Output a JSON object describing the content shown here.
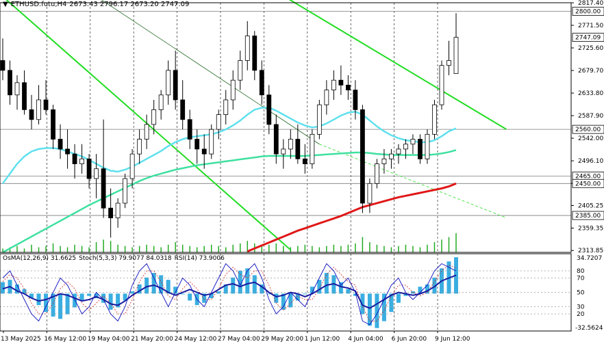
{
  "header": {
    "symbol": "ETHUSD.futu,H4",
    "ohlc": "2673.43 2796.17 2673.20 2747.09"
  },
  "indicator_header": {
    "osma": "OsMA(12,26,9) 31.6625",
    "stoch": "Stoch(5,3,3) 79.9077 84.0318",
    "rsi": "RSI(14) 73.9006"
  },
  "colors": {
    "candle": "#000000",
    "ma_fast": "#5fe0ee",
    "ma_mid": "#3ee0a0",
    "ma_slow": "#e01818",
    "trendline": "#22dd22",
    "osma": "#3aaee0",
    "stoch_main": "#1010c0",
    "stoch_signal": "#d02020",
    "rsi": "#1a1aa0",
    "price_box": "#ffffff"
  },
  "chart_data": [
    {
      "type": "candlestick",
      "title": "ETHUSD.futu,H4",
      "ylim": [
        2310,
        2817.4
      ],
      "y_ticks": [
        "2817.40",
        "2771.50",
        "2725.60",
        "2679.70",
        "2633.80",
        "2587.90",
        "2542.00",
        "2496.10",
        "2450.20",
        "2405.25",
        "2359.35",
        "2313.85"
      ],
      "price_labels": [
        "2800.00",
        "2747.09",
        "2560.00",
        "2465.00",
        "2450.00",
        "2385.00"
      ],
      "levels": [
        2800.0,
        2560.0,
        2465.0,
        2450.0,
        2385.0
      ],
      "current_price": 2747.09,
      "x_labels": [
        "13 May 2025",
        "16 May 12:00",
        "19 May 04:00",
        "21 May 20:00",
        "24 May 12:00",
        "27 May 04:00",
        "29 May 20:00",
        "1 Jun 12:00",
        "4 Jun 04:00",
        "6 Jun 20:00",
        "9 Jun 12:00"
      ],
      "candles": [
        [
          2700,
          2745,
          2660,
          2680
        ],
        [
          2680,
          2700,
          2610,
          2630
        ],
        [
          2630,
          2670,
          2600,
          2655
        ],
        [
          2655,
          2680,
          2590,
          2600
        ],
        [
          2600,
          2630,
          2560,
          2580
        ],
        [
          2580,
          2650,
          2570,
          2620
        ],
        [
          2620,
          2660,
          2590,
          2600
        ],
        [
          2600,
          2610,
          2520,
          2540
        ],
        [
          2540,
          2570,
          2500,
          2520
        ],
        [
          2520,
          2560,
          2480,
          2510
        ],
        [
          2510,
          2530,
          2460,
          2490
        ],
        [
          2490,
          2530,
          2470,
          2500
        ],
        [
          2500,
          2510,
          2440,
          2460
        ],
        [
          2460,
          2510,
          2420,
          2480
        ],
        [
          2480,
          2580,
          2380,
          2400
        ],
        [
          2400,
          2440,
          2340,
          2380
        ],
        [
          2380,
          2420,
          2360,
          2410
        ],
        [
          2410,
          2470,
          2400,
          2460
        ],
        [
          2460,
          2520,
          2440,
          2510
        ],
        [
          2510,
          2560,
          2490,
          2540
        ],
        [
          2540,
          2590,
          2520,
          2570
        ],
        [
          2570,
          2620,
          2550,
          2600
        ],
        [
          2600,
          2640,
          2580,
          2630
        ],
        [
          2630,
          2700,
          2610,
          2680
        ],
        [
          2680,
          2720,
          2600,
          2620
        ],
        [
          2620,
          2660,
          2560,
          2580
        ],
        [
          2580,
          2600,
          2520,
          2540
        ],
        [
          2540,
          2560,
          2490,
          2520
        ],
        [
          2520,
          2550,
          2480,
          2510
        ],
        [
          2510,
          2570,
          2500,
          2560
        ],
        [
          2560,
          2600,
          2540,
          2590
        ],
        [
          2590,
          2640,
          2570,
          2620
        ],
        [
          2620,
          2680,
          2600,
          2660
        ],
        [
          2660,
          2720,
          2640,
          2700
        ],
        [
          2700,
          2780,
          2680,
          2750
        ],
        [
          2750,
          2760,
          2660,
          2680
        ],
        [
          2680,
          2700,
          2610,
          2630
        ],
        [
          2630,
          2650,
          2550,
          2570
        ],
        [
          2570,
          2590,
          2490,
          2510
        ],
        [
          2510,
          2540,
          2480,
          2520
        ],
        [
          2520,
          2560,
          2500,
          2540
        ],
        [
          2540,
          2570,
          2490,
          2500
        ],
        [
          2500,
          2530,
          2470,
          2490
        ],
        [
          2490,
          2560,
          2480,
          2550
        ],
        [
          2550,
          2620,
          2540,
          2610
        ],
        [
          2610,
          2660,
          2590,
          2640
        ],
        [
          2640,
          2680,
          2620,
          2660
        ],
        [
          2660,
          2690,
          2630,
          2650
        ],
        [
          2650,
          2670,
          2620,
          2640
        ],
        [
          2640,
          2660,
          2580,
          2600
        ],
        [
          2600,
          2610,
          2390,
          2410
        ],
        [
          2410,
          2460,
          2390,
          2450
        ],
        [
          2450,
          2500,
          2440,
          2490
        ],
        [
          2490,
          2520,
          2470,
          2500
        ],
        [
          2500,
          2520,
          2480,
          2510
        ],
        [
          2510,
          2530,
          2490,
          2520
        ],
        [
          2520,
          2540,
          2500,
          2530
        ],
        [
          2530,
          2550,
          2510,
          2540
        ],
        [
          2540,
          2550,
          2490,
          2500
        ],
        [
          2500,
          2560,
          2490,
          2550
        ],
        [
          2550,
          2620,
          2540,
          2610
        ],
        [
          2610,
          2700,
          2600,
          2690
        ],
        [
          2690,
          2740,
          2670,
          2700
        ],
        [
          2673.43,
          2796.17,
          2673.2,
          2747.09
        ]
      ],
      "ma_fast": [
        2450,
        2470,
        2490,
        2505,
        2515,
        2520,
        2522,
        2522,
        2520,
        2515,
        2510,
        2505,
        2498,
        2490,
        2482,
        2476,
        2474,
        2478,
        2484,
        2492,
        2500,
        2508,
        2516,
        2526,
        2534,
        2540,
        2544,
        2546,
        2548,
        2550,
        2554,
        2560,
        2568,
        2578,
        2590,
        2600,
        2604,
        2604,
        2598,
        2590,
        2582,
        2574,
        2568,
        2564,
        2566,
        2572,
        2580,
        2588,
        2594,
        2596,
        2590,
        2578,
        2566,
        2556,
        2548,
        2542,
        2538,
        2536,
        2534,
        2534,
        2538,
        2546,
        2556,
        2562
      ],
      "ma_mid": [
        2310,
        2318,
        2326,
        2334,
        2342,
        2350,
        2358,
        2366,
        2374,
        2382,
        2390,
        2398,
        2406,
        2413,
        2420,
        2427,
        2434,
        2441,
        2448,
        2455,
        2461,
        2466,
        2470,
        2474,
        2478,
        2481,
        2484,
        2487,
        2489,
        2491,
        2493,
        2495,
        2497,
        2499,
        2501,
        2503,
        2505,
        2506,
        2506,
        2506,
        2506,
        2506,
        2506,
        2507,
        2508,
        2509,
        2510,
        2511,
        2512,
        2513,
        2513,
        2512,
        2510,
        2509,
        2508,
        2508,
        2508,
        2508,
        2508,
        2508,
        2509,
        2511,
        2514,
        2518
      ],
      "ma_slow": [
        null,
        null,
        null,
        null,
        null,
        null,
        null,
        null,
        null,
        null,
        null,
        null,
        null,
        null,
        null,
        null,
        null,
        null,
        null,
        null,
        null,
        null,
        null,
        null,
        null,
        null,
        null,
        null,
        null,
        null,
        null,
        null,
        null,
        null,
        2312,
        2318,
        2324,
        2330,
        2336,
        2342,
        2348,
        2354,
        2359,
        2364,
        2369,
        2374,
        2379,
        2384,
        2390,
        2396,
        2402,
        2406,
        2410,
        2414,
        2418,
        2422,
        2425,
        2428,
        2431,
        2434,
        2437,
        2440,
        2444,
        2450
      ],
      "trendlines": [
        {
          "name": "green-1",
          "from": [
            0,
            2830
          ],
          "to": [
            40,
            2315
          ]
        },
        {
          "name": "green-2",
          "from": [
            38,
            2840
          ],
          "to": [
            70,
            2560
          ]
        },
        {
          "name": "dark-channel",
          "from": [
            12,
            2840
          ],
          "to": [
            44,
            2530
          ]
        },
        {
          "name": "dashed-extension",
          "from": [
            44,
            2530
          ],
          "to": [
            70,
            2380
          ]
        }
      ],
      "volume": [
        3,
        4,
        5,
        3,
        6,
        4,
        5,
        7,
        5,
        4,
        6,
        5,
        4,
        8,
        10,
        9,
        6,
        5,
        4,
        5,
        6,
        5,
        4,
        6,
        8,
        6,
        5,
        4,
        5,
        6,
        5,
        4,
        6,
        7,
        9,
        7,
        5,
        6,
        7,
        5,
        4,
        5,
        6,
        5,
        4,
        5,
        6,
        5,
        6,
        7,
        12,
        8,
        6,
        5,
        4,
        5,
        6,
        5,
        4,
        6,
        8,
        10,
        12,
        15
      ]
    },
    {
      "type": "bar",
      "name": "OsMA(12,26,9)",
      "ylim": [
        -32.5624,
        34.7207
      ],
      "y_ticks": [
        "34.7207",
        "-32.5624"
      ],
      "values": [
        10,
        12,
        8,
        4,
        -4,
        -10,
        -16,
        -20,
        -22,
        -18,
        -12,
        -6,
        -2,
        -4,
        -8,
        -14,
        -12,
        -6,
        2,
        8,
        14,
        18,
        16,
        12,
        6,
        0,
        -6,
        -10,
        -8,
        -4,
        2,
        8,
        14,
        20,
        22,
        16,
        8,
        0,
        -8,
        -14,
        -12,
        -6,
        0,
        6,
        12,
        18,
        16,
        10,
        4,
        -2,
        -18,
        -28,
        -30,
        -24,
        -16,
        -8,
        -2,
        2,
        6,
        8,
        14,
        22,
        28,
        31.66
      ]
    },
    {
      "type": "line",
      "name": "Stoch(5,3,3)",
      "ylim": [
        0,
        100
      ],
      "y_ticks": [
        "80",
        "70",
        "50",
        "30",
        "20"
      ],
      "main": [
        70,
        80,
        60,
        40,
        20,
        10,
        30,
        50,
        70,
        60,
        40,
        20,
        30,
        50,
        40,
        20,
        10,
        30,
        60,
        80,
        90,
        70,
        50,
        30,
        50,
        70,
        60,
        40,
        30,
        50,
        70,
        90,
        80,
        60,
        80,
        90,
        70,
        40,
        20,
        30,
        50,
        40,
        30,
        50,
        70,
        90,
        80,
        60,
        70,
        50,
        10,
        5,
        20,
        40,
        60,
        70,
        50,
        40,
        50,
        60,
        80,
        90,
        85,
        79.91
      ],
      "signal": [
        65,
        75,
        70,
        55,
        35,
        20,
        20,
        35,
        55,
        65,
        55,
        35,
        25,
        35,
        45,
        35,
        20,
        20,
        40,
        65,
        80,
        80,
        65,
        45,
        40,
        55,
        65,
        55,
        40,
        40,
        55,
        75,
        85,
        75,
        70,
        80,
        80,
        60,
        35,
        25,
        35,
        45,
        40,
        40,
        55,
        75,
        85,
        75,
        65,
        60,
        30,
        10,
        10,
        25,
        45,
        60,
        60,
        50,
        45,
        50,
        65,
        80,
        88,
        84.03
      ]
    },
    {
      "type": "line",
      "name": "RSI(14)",
      "ylim": [
        0,
        100
      ],
      "values": [
        55,
        58,
        52,
        48,
        42,
        38,
        40,
        44,
        48,
        46,
        42,
        38,
        40,
        44,
        40,
        34,
        32,
        38,
        46,
        52,
        58,
        60,
        56,
        50,
        46,
        50,
        54,
        50,
        46,
        48,
        54,
        60,
        62,
        58,
        62,
        64,
        58,
        50,
        44,
        46,
        50,
        48,
        44,
        48,
        54,
        60,
        62,
        58,
        56,
        52,
        32,
        28,
        34,
        40,
        46,
        50,
        48,
        46,
        48,
        52,
        58,
        66,
        70,
        73.9
      ]
    }
  ]
}
